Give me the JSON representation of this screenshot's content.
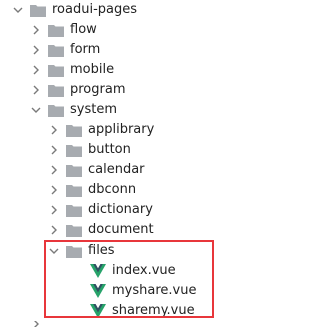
{
  "tree": {
    "root": "roadui-pages",
    "items": [
      {
        "label": "flow"
      },
      {
        "label": "form"
      },
      {
        "label": "mobile"
      },
      {
        "label": "program"
      },
      {
        "label": "system"
      }
    ],
    "system_children": [
      {
        "label": "applibrary"
      },
      {
        "label": "button"
      },
      {
        "label": "calendar"
      },
      {
        "label": "dbconn"
      },
      {
        "label": "dictionary"
      },
      {
        "label": "document"
      },
      {
        "label": "files"
      }
    ],
    "files_children": [
      {
        "label": "index.vue"
      },
      {
        "label": "myshare.vue"
      },
      {
        "label": "sharemy.vue"
      }
    ]
  },
  "colors": {
    "folder": "#a7abb0",
    "vue_dark": "#2f4f62",
    "vue_green": "#27a36a",
    "highlight": "#e8363b",
    "chevron": "#7a7a7a"
  }
}
